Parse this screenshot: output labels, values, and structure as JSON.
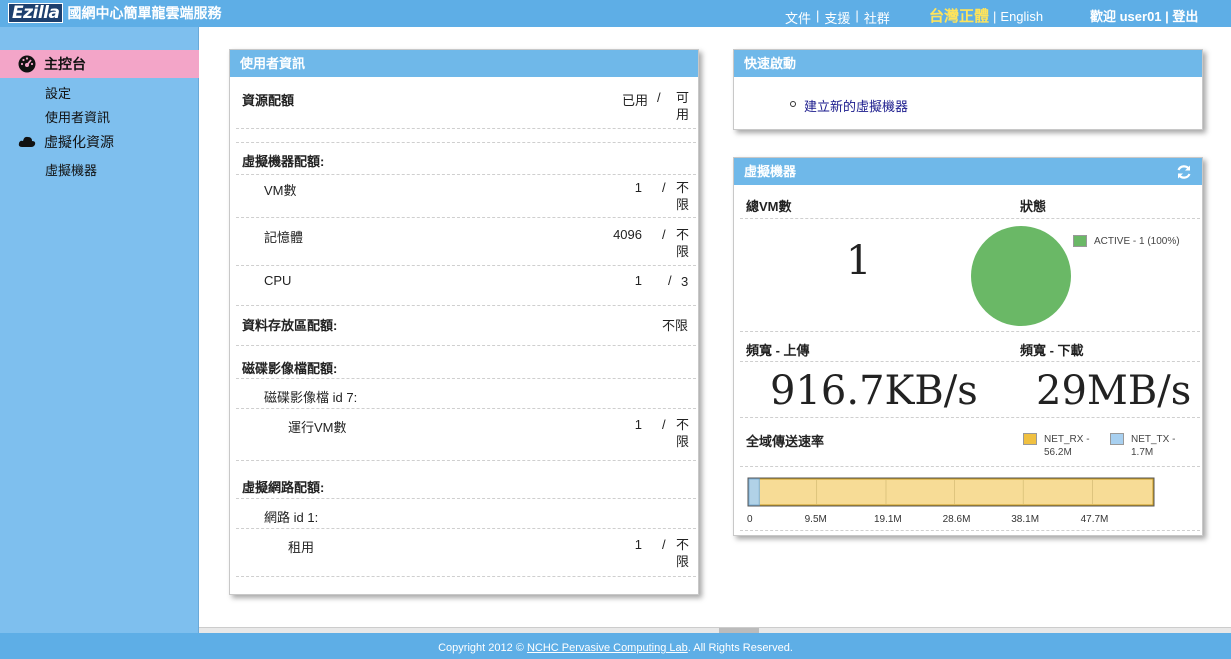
{
  "header": {
    "logo": "Ezilla",
    "title": "國網中心簡單龍雲端服務",
    "links": [
      "文件",
      "支援",
      "社群"
    ],
    "lang_zh": "台灣正體",
    "lang_en": "English",
    "welcome": "歡迎 user01",
    "logout": "登出",
    "color_bg": "#5eaee6"
  },
  "sidebar": {
    "dashboard": "主控台",
    "settings": "設定",
    "user_info": "使用者資訊",
    "virtual_resources": "虛擬化資源",
    "vms": "虛擬機器",
    "active_color": "#f3a5c8"
  },
  "user_panel": {
    "title": "使用者資訊",
    "quota_label": "資源配額",
    "used_label": "已用",
    "avail_label": "可用",
    "vm_quota": "虛擬機器配額:",
    "vm_count_label": "VM數",
    "vm_count_used": "1",
    "vm_count_avail": "不限",
    "memory_label": "記憶體",
    "memory_used": "4096",
    "memory_avail": "不限",
    "cpu_label": "CPU",
    "cpu_used": "1",
    "cpu_avail": "3",
    "storage_quota": "資料存放區配額:",
    "storage_avail": "不限",
    "image_quota": "磁碟影像檔配額:",
    "image_id": "磁碟影像檔 id 7:",
    "running_vms_label": "運行VM數",
    "running_vms_used": "1",
    "running_vms_avail": "不限",
    "network_quota": "虛擬網路配額:",
    "network_id": "網路 id 1:",
    "lease_label": "租用",
    "lease_used": "1",
    "lease_avail": "不限"
  },
  "quick_start": {
    "title": "快速啟動",
    "create_vm": "建立新的虛擬機器"
  },
  "vm_panel": {
    "title": "虛擬機器",
    "total_label": "總VM數",
    "total_value": "1",
    "status_label": "狀態",
    "status_legend": "ACTIVE - 1 (100%)",
    "status_color": "#6ab866",
    "upload_label": "頻寬 - 上傳",
    "upload_value": "916.7KB/s",
    "download_label": "頻寬 - 下載",
    "download_value": "29MB/s",
    "transfer_label": "全域傳送速率",
    "rx_legend_1": "NET_RX -",
    "rx_legend_2": "56.2M",
    "tx_legend_1": "NET_TX -",
    "tx_legend_2": "1.7M",
    "rx_color": "#f0c040",
    "tx_color": "#a8d0f0"
  },
  "chart_data": {
    "type": "bar",
    "categories": [
      "NET_RX",
      "NET_TX"
    ],
    "values": [
      56.2,
      1.7
    ],
    "unit": "M",
    "xlim": [
      0,
      56.2
    ],
    "tick_labels": [
      "0",
      "9.5M",
      "19.1M",
      "28.6M",
      "38.1M",
      "47.7M"
    ],
    "ticks": [
      0,
      9.5,
      19.1,
      28.6,
      38.1,
      47.7
    ]
  },
  "footer": {
    "copyright_pre": "Copyright 2012 ©",
    "lab": "NCHC Pervasive Computing Lab",
    "copyright_post": ". All Rights Reserved."
  }
}
